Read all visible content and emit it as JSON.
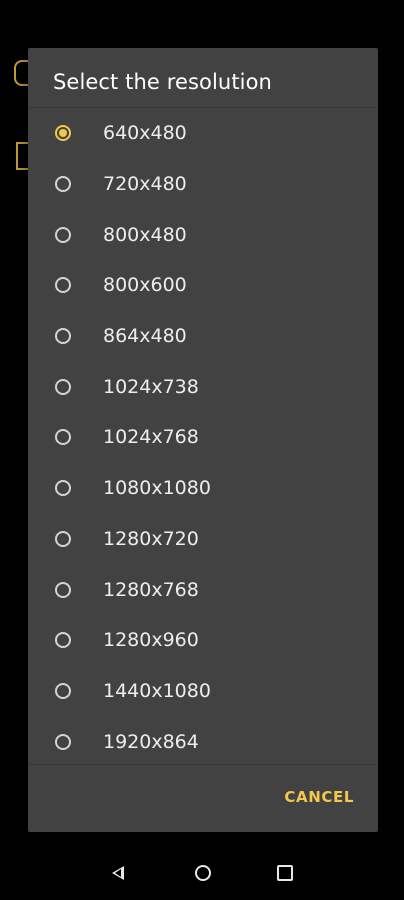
{
  "dialog": {
    "title": "Select the resolution",
    "options": [
      {
        "label": "640x480",
        "selected": true
      },
      {
        "label": "720x480",
        "selected": false
      },
      {
        "label": "800x480",
        "selected": false
      },
      {
        "label": "800x600",
        "selected": false
      },
      {
        "label": "864x480",
        "selected": false
      },
      {
        "label": "1024x738",
        "selected": false
      },
      {
        "label": "1024x768",
        "selected": false
      },
      {
        "label": "1080x1080",
        "selected": false
      },
      {
        "label": "1280x720",
        "selected": false
      },
      {
        "label": "1280x768",
        "selected": false
      },
      {
        "label": "1280x960",
        "selected": false
      },
      {
        "label": "1440x1080",
        "selected": false
      },
      {
        "label": "1920x864",
        "selected": false
      }
    ],
    "cancel_label": "CANCEL"
  },
  "navbar": {
    "back_icon": "back-triangle-icon",
    "home_icon": "home-circle-icon",
    "recents_icon": "recents-square-icon"
  },
  "colors": {
    "accent": "#f2c94c",
    "dialog_bg": "#424242",
    "screen_bg": "#000000"
  }
}
